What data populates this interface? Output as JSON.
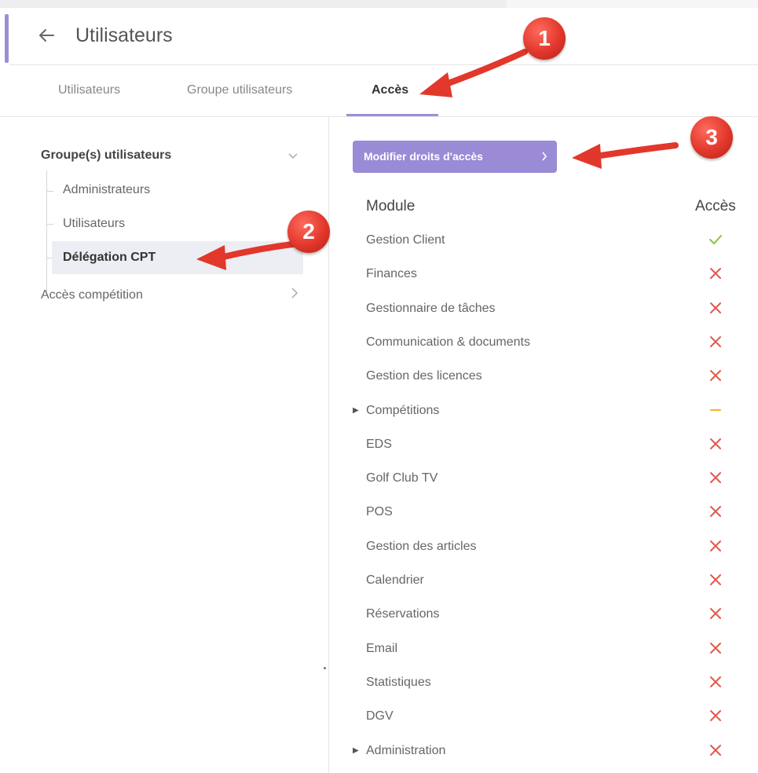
{
  "header": {
    "title": "Utilisateurs"
  },
  "tabs": [
    {
      "label": "Utilisateurs",
      "active": false
    },
    {
      "label": "Groupe utilisateurs",
      "active": false
    },
    {
      "label": "Accès",
      "active": true
    }
  ],
  "sidebar": {
    "group_title": "Groupe(s) utilisateurs",
    "items": [
      {
        "label": "Administrateurs",
        "selected": false
      },
      {
        "label": "Utilisateurs",
        "selected": false
      },
      {
        "label": "Délégation CPT",
        "selected": true
      }
    ],
    "competition_access": "Accès compétition"
  },
  "main": {
    "modify_button": "Modifier droits d'accès",
    "columns": {
      "module": "Module",
      "access": "Accès"
    },
    "rows": [
      {
        "name": "Gestion Client",
        "status": "check",
        "expandable": false
      },
      {
        "name": "Finances",
        "status": "cross",
        "expandable": false
      },
      {
        "name": "Gestionnaire de tâches",
        "status": "cross",
        "expandable": false
      },
      {
        "name": "Communication & documents",
        "status": "cross",
        "expandable": false
      },
      {
        "name": "Gestion des licences",
        "status": "cross",
        "expandable": false
      },
      {
        "name": "Compétitions",
        "status": "partial",
        "expandable": true
      },
      {
        "name": "EDS",
        "status": "cross",
        "expandable": false
      },
      {
        "name": "Golf Club TV",
        "status": "cross",
        "expandable": false
      },
      {
        "name": "POS",
        "status": "cross",
        "expandable": false
      },
      {
        "name": "Gestion des articles",
        "status": "cross",
        "expandable": false
      },
      {
        "name": "Calendrier",
        "status": "cross",
        "expandable": false
      },
      {
        "name": "Réservations",
        "status": "cross",
        "expandable": false
      },
      {
        "name": "Email",
        "status": "cross",
        "expandable": false
      },
      {
        "name": "Statistiques",
        "status": "cross",
        "expandable": false
      },
      {
        "name": "DGV",
        "status": "cross",
        "expandable": false
      },
      {
        "name": "Administration",
        "status": "cross",
        "expandable": true
      }
    ]
  },
  "annotations": [
    {
      "number": "1"
    },
    {
      "number": "2"
    },
    {
      "number": "3"
    }
  ],
  "colors": {
    "accent": "#9c8fd6",
    "button": "#9b8ad6",
    "check": "#8bc34a",
    "cross": "#e05a4f",
    "partial": "#f0b429",
    "annotation": "#e2372b"
  },
  "icons": {
    "back": "arrow-left-icon",
    "group_chevron": "chevron-down-icon",
    "competition_chevron": "chevron-right-icon",
    "button_chevron": "chevron-right-icon",
    "expand": "caret-right-icon",
    "status": {
      "check": "check-icon",
      "cross": "cross-icon",
      "partial": "dash-icon"
    }
  }
}
